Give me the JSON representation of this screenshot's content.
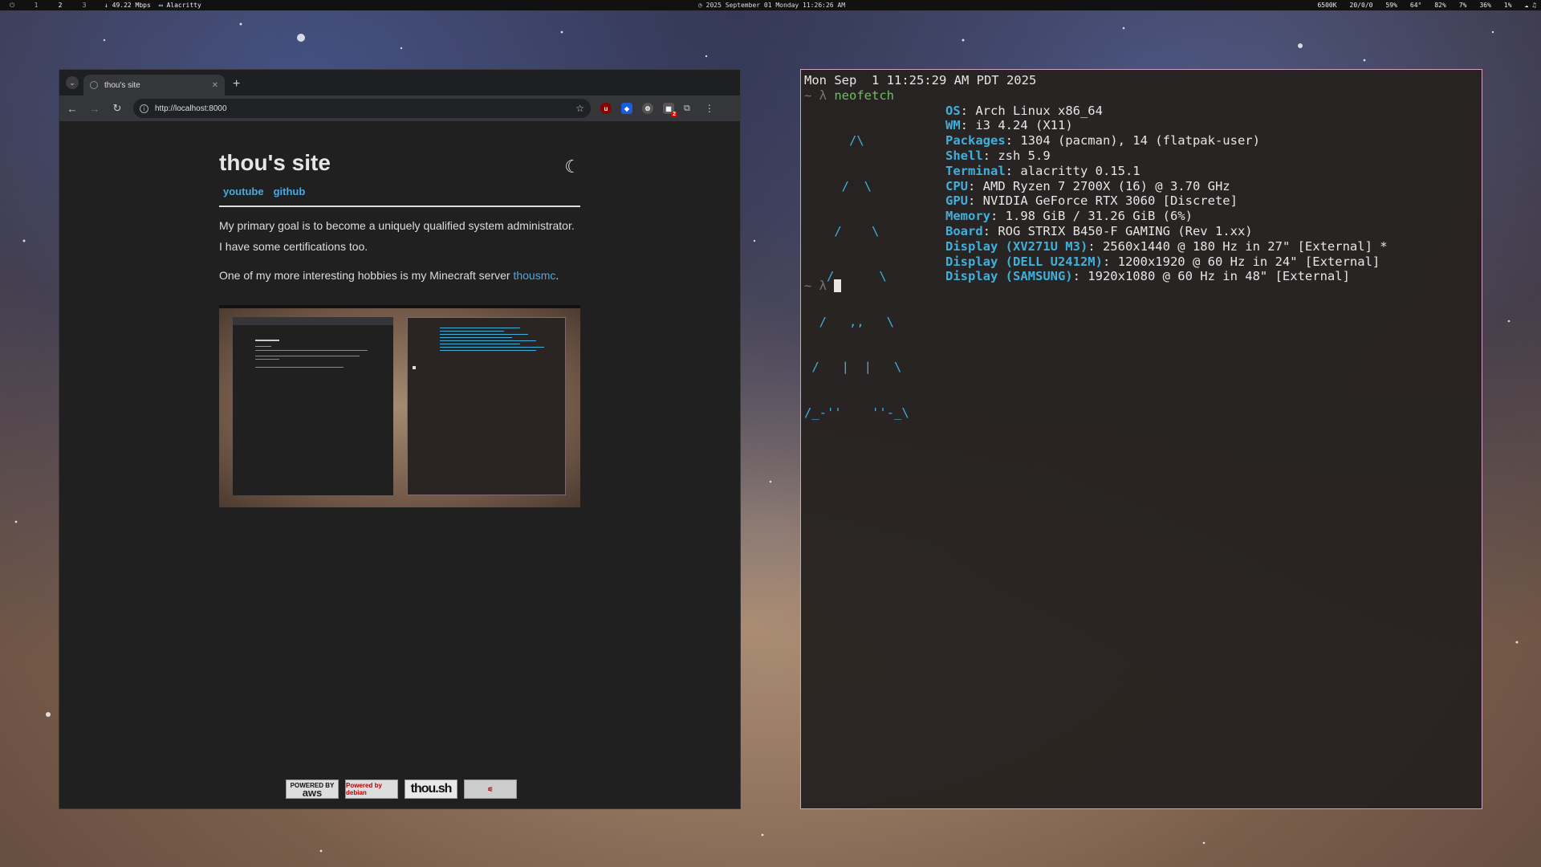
{
  "topbar": {
    "workspaces": [
      "1",
      "2",
      "3"
    ],
    "net_speed": "49.22 Mbps",
    "focused_window": "Alacritty",
    "clock": "2025 September 01 Monday 11:26:26 AM",
    "status": [
      "6500K",
      "20/0/0",
      "59%",
      "64°",
      "82%",
      "7%",
      "36%",
      "1%"
    ]
  },
  "browser": {
    "tab_title": "thou's site",
    "url": "http://localhost:8000",
    "ext_badge": "2",
    "page": {
      "title": "thou's site",
      "links": [
        "youtube",
        "github"
      ],
      "para1": "My primary goal is to become a uniquely qualified system administrator. I have some certifications too.",
      "para2_prefix": "One of my more interesting hobbies is my Minecraft server ",
      "para2_link": "thousmc",
      "para2_suffix": ".",
      "badges": {
        "aws_top": "POWERED BY",
        "aws_main": "aws",
        "debian": "Powered by debian",
        "thou": "thou.sh"
      }
    }
  },
  "terminal": {
    "date_line": "Mon Sep  1 11:25:29 AM PDT 2025",
    "prompt": "~ λ ",
    "command": "neofetch",
    "info": [
      {
        "key": "OS",
        "value": ": Arch Linux x86_64"
      },
      {
        "key": "WM",
        "value": ": i3 4.24 (X11)"
      },
      {
        "key": "Packages",
        "value": ": 1304 (pacman), 14 (flatpak-user)"
      },
      {
        "key": "Shell",
        "value": ": zsh 5.9"
      },
      {
        "key": "Terminal",
        "value": ": alacritty 0.15.1"
      },
      {
        "key": "CPU",
        "value": ": AMD Ryzen 7 2700X (16) @ 3.70 GHz"
      },
      {
        "key": "GPU",
        "value": ": NVIDIA GeForce RTX 3060 [Discrete]"
      },
      {
        "key": "Memory",
        "value": ": 1.98 GiB / 31.26 GiB (6%)"
      },
      {
        "key": "Board",
        "value": ": ROG STRIX B450-F GAMING (Rev 1.xx)"
      },
      {
        "key": "Display (XV271U M3)",
        "value": ": 2560x1440 @ 180 Hz in 27\" [External] *"
      },
      {
        "key": "Display (DELL U2412M)",
        "value": ": 1200x1920 @ 60 Hz in 24\" [External]"
      },
      {
        "key": "Display (SAMSUNG)",
        "value": ": 1920x1080 @ 60 Hz in 48\" [External]"
      }
    ],
    "art": [
      "      /\\",
      "     /  \\",
      "    /    \\",
      "   /      \\",
      "  /   ,,   \\",
      " /   |  |   \\",
      "/_-''    ''-_\\"
    ]
  },
  "colors": {
    "accent_link": "#4ea8de",
    "terminal_key": "#3fb0dc",
    "terminal_border": "#d4a0c0"
  }
}
